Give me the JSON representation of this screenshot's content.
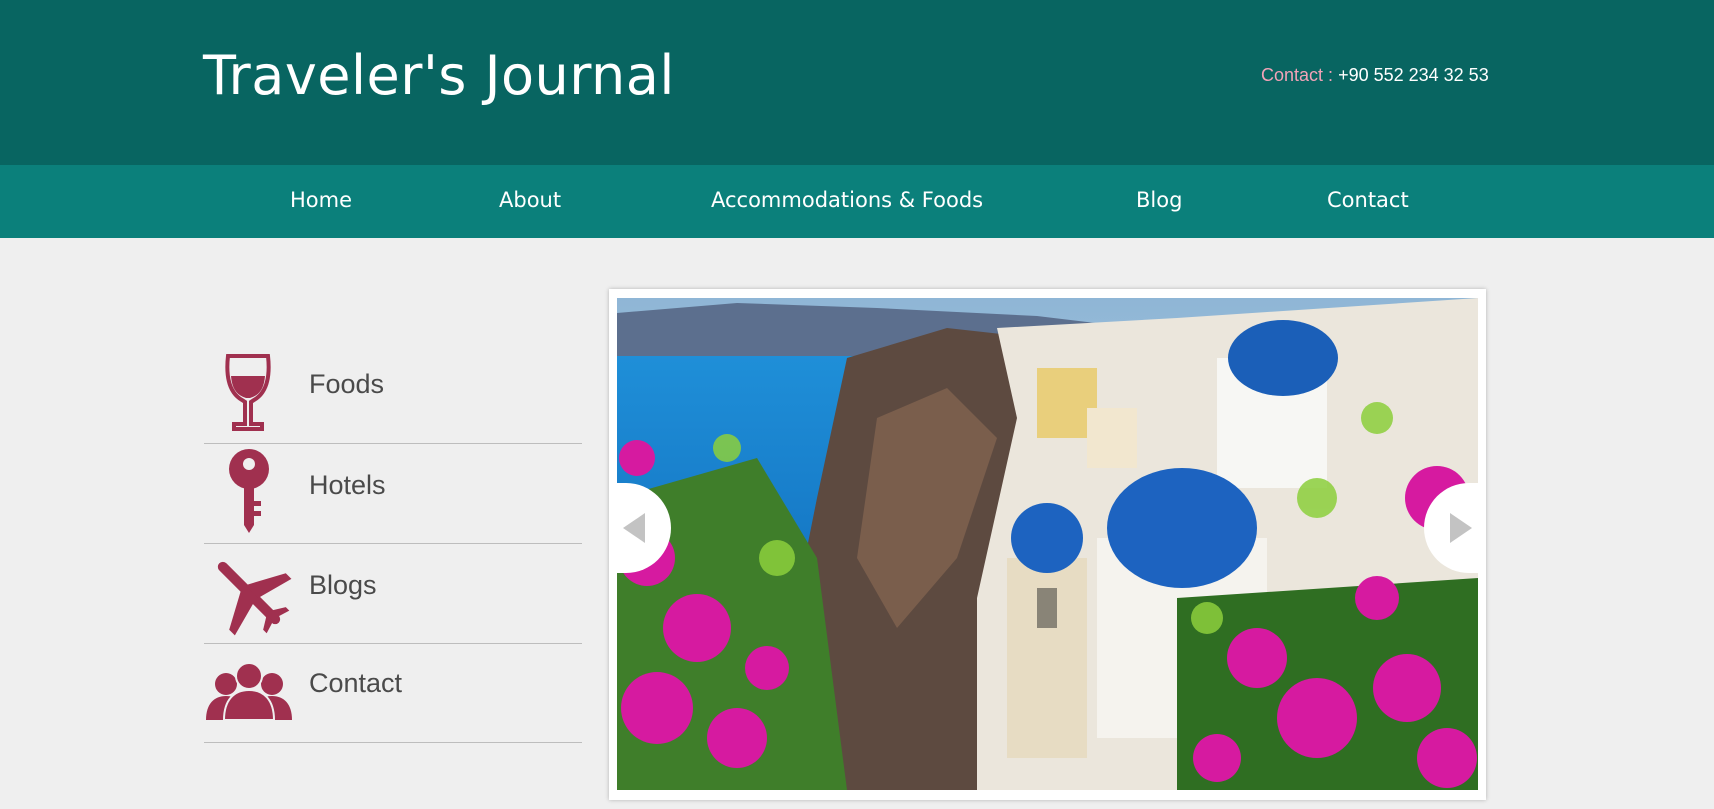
{
  "header": {
    "title": "Traveler's Journal",
    "contact_label": "Contact :",
    "contact_phone": "+90 552 234 32 53"
  },
  "nav": {
    "items": [
      "Home",
      "About",
      "Accommodations & Foods",
      "Blog",
      "Contact"
    ]
  },
  "side_menu": {
    "items": [
      {
        "label": "Foods",
        "icon": "wine-glass-icon"
      },
      {
        "label": "Hotels",
        "icon": "key-icon"
      },
      {
        "label": "Blogs",
        "icon": "airplane-icon"
      },
      {
        "label": "Contact",
        "icon": "people-icon"
      }
    ]
  },
  "slider": {
    "image": "santorini-photo",
    "prev_icon": "chevron-left-icon",
    "next_icon": "chevron-right-icon"
  },
  "colors": {
    "header_bg": "#086561",
    "nav_bg": "#0b807b",
    "accent": "#a0304f",
    "contact_label": "#f2a3b8"
  }
}
